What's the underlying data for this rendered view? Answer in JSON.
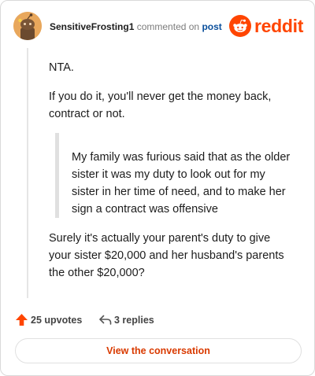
{
  "header": {
    "username": "SensitiveFrosting1",
    "action_text": "commented on",
    "post_link": "post",
    "logo_text": "reddit"
  },
  "comment": {
    "paragraph_1": "NTA.",
    "paragraph_2": "If you do it, you'll never get the money back, contract or not.",
    "quote": "My family was furious said that as the older sister it was my duty to look out for my sister in her time of need, and to make her sign a contract was offensive",
    "paragraph_3": "Surely it's actually your parent's duty to give your sister $20,000 and her husband's parents the other $20,000?"
  },
  "actions": {
    "upvotes_label": "25 upvotes",
    "replies_label": "3 replies"
  },
  "cta": {
    "label": "View the conversation"
  },
  "icons": {
    "avatar": "snoo-avatar-icon",
    "logo": "reddit-logo-icon",
    "upvote": "upvote-arrow-icon",
    "reply": "reply-arrow-icon"
  },
  "colors": {
    "brand": "#ff4500",
    "cta_text": "#d93a00",
    "link": "#0a4f9c",
    "avatar_bg": "#e8a75c"
  }
}
